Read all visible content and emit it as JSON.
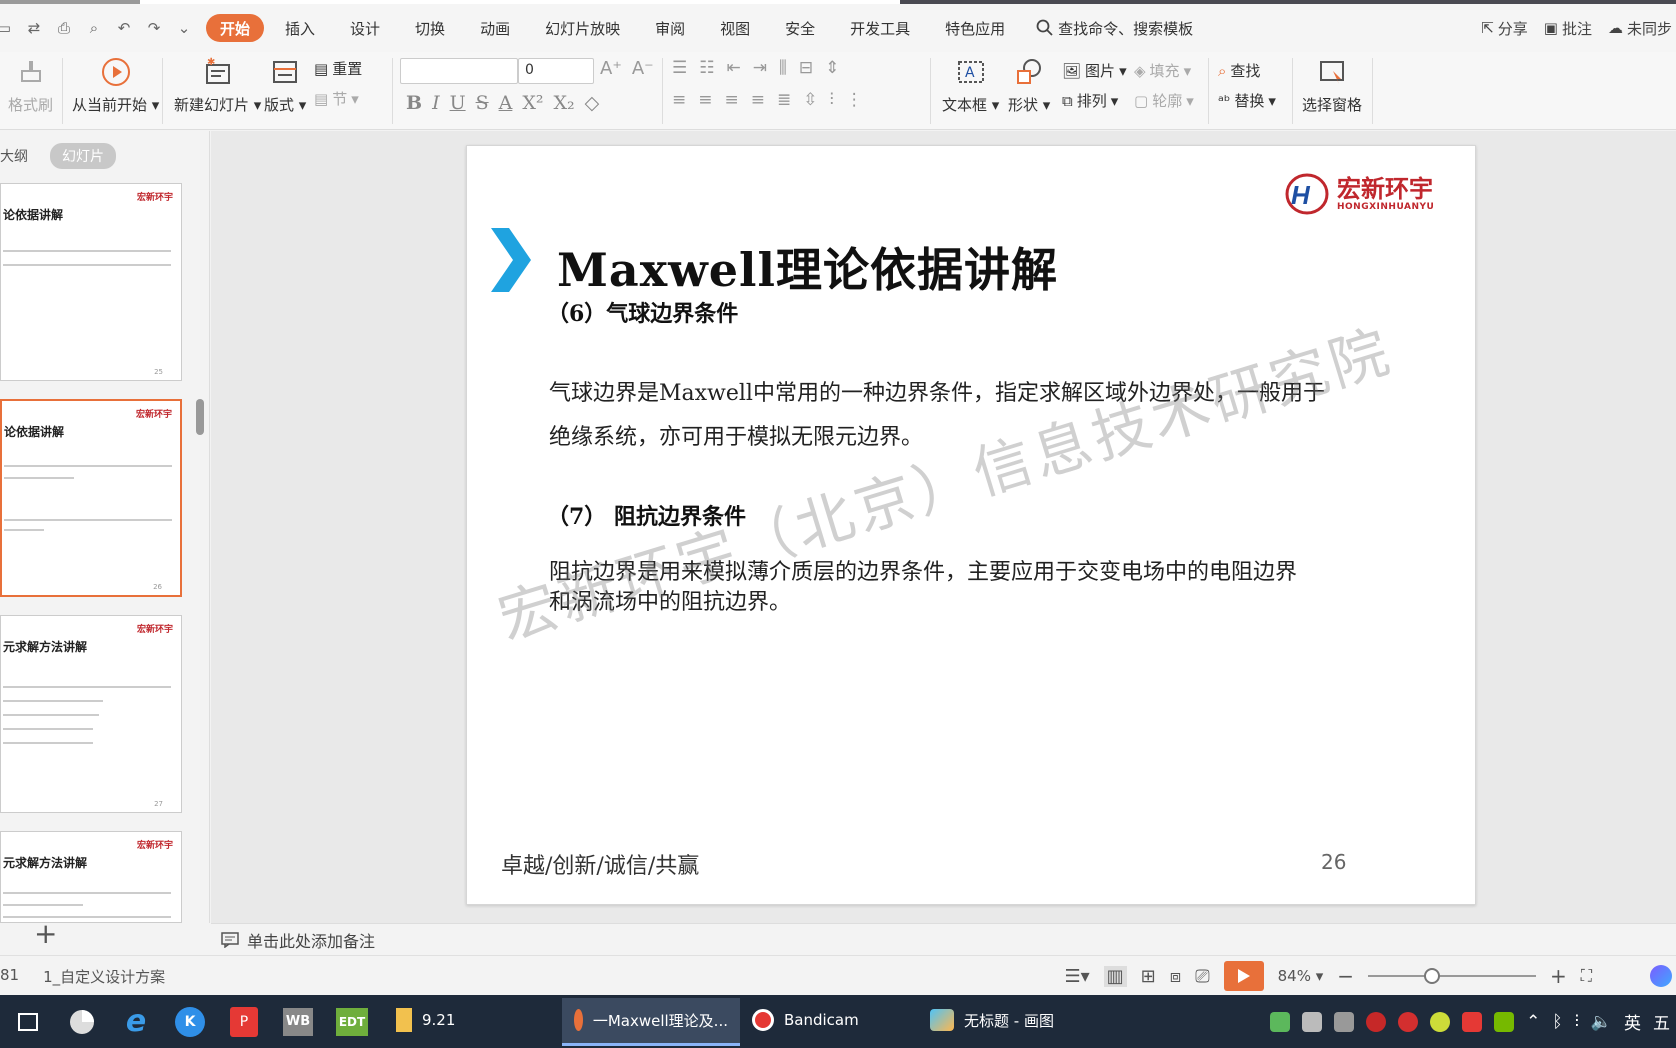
{
  "menubar": {
    "tabs": [
      "开始",
      "插入",
      "设计",
      "切换",
      "动画",
      "幻灯片放映",
      "审阅",
      "视图",
      "安全",
      "开发工具",
      "特色应用"
    ],
    "active_tab": "开始",
    "search_label": "查找命令、搜索模板",
    "share": "分享",
    "comment": "批注",
    "sync": "未同步"
  },
  "ribbon": {
    "format_painter": "格式刷",
    "from_current": "从当前开始",
    "new_slide": "新建幻灯片",
    "layout": "版式",
    "reset": "重置",
    "section": "节",
    "font_name": "",
    "font_size": "0",
    "textbox": "文本框",
    "shape": "形状",
    "picture": "图片",
    "fill": "填充",
    "arrange": "排列",
    "outline": "轮廓",
    "find": "查找",
    "replace": "替换",
    "selection_pane": "选择窗格"
  },
  "leftpanel": {
    "tab_outline": "大纲",
    "tab_slides": "幻灯片",
    "thumbs": [
      {
        "title": "论依据讲解",
        "num": "25"
      },
      {
        "title": "论依据讲解",
        "num": "26"
      },
      {
        "title": "元求解方法讲解",
        "num": "27"
      },
      {
        "title": "元求解方法讲解",
        "num": ""
      }
    ],
    "thumb_logo": "宏新环宇"
  },
  "slide": {
    "title": "Maxwell理论依据讲解",
    "logo_cn": "宏新环宇",
    "logo_en": "HONGXINHUANYU",
    "section6": "（6）气球边界条件",
    "body6_line1": "气球边界是Maxwell中常用的一种边界条件，指定求解区域外边界处，一般用于",
    "body6_line2": "绝缘系统，亦可用于模拟无限元边界。",
    "section7": "（7） 阻抗边界条件",
    "body7_line1": "阻抗边界是用来模拟薄介质层的边界条件，主要应用于交变电场中的电阻边界",
    "body7_line2": "和涡流场中的阻抗边界。",
    "footer": "卓越/创新/诚信/共赢",
    "page_number": "26",
    "watermark": "宏新环宇（北京）信息技术研究院"
  },
  "notes": {
    "placeholder": "单击此处添加备注"
  },
  "statusbar": {
    "slide_count": "81",
    "theme": "1_自定义设计方案",
    "zoom": "84%",
    "zoom_fraction": 0.38
  },
  "taskbar": {
    "apps": [
      {
        "label": "9.21"
      },
      {
        "label": "一Maxwell理论及..."
      },
      {
        "label": "Bandicam"
      },
      {
        "label": "无标题 - 画图"
      }
    ],
    "tray_lang": "英",
    "tray_extra": "五"
  },
  "colors": {
    "accent": "#e8703a",
    "brand_red": "#c0272d",
    "brand_blue": "#1e4fa3",
    "chevron": "#1fa3e0"
  }
}
